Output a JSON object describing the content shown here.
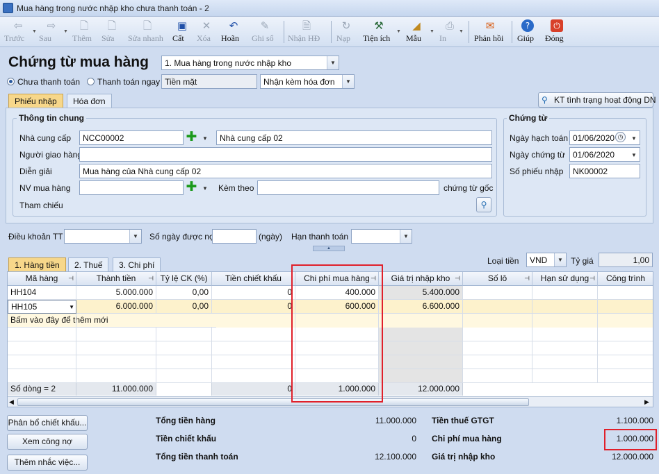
{
  "window": {
    "title": "Mua hàng trong nước nhập kho chưa thanh toán - 2"
  },
  "toolbar": {
    "items": [
      {
        "label": "Trước",
        "icon": "arrow-left-icon"
      },
      {
        "label": "Sau",
        "icon": "arrow-right-icon"
      },
      {
        "label": "Thêm",
        "icon": "add-document-icon"
      },
      {
        "label": "Sửa",
        "icon": "edit-document-icon"
      },
      {
        "label": "Sửa nhanh",
        "icon": "quick-edit-icon"
      },
      {
        "label": "Cất",
        "icon": "save-icon"
      },
      {
        "label": "Xóa",
        "icon": "delete-icon"
      },
      {
        "label": "Hoãn",
        "icon": "undo-icon"
      },
      {
        "label": "Ghi sổ",
        "icon": "pencil-icon"
      },
      {
        "label": "Nhận HĐ",
        "icon": "receive-invoice-icon"
      },
      {
        "label": "Nạp",
        "icon": "reload-icon"
      },
      {
        "label": "Tiện ích",
        "icon": "tools-icon"
      },
      {
        "label": "Mẫu",
        "icon": "template-icon"
      },
      {
        "label": "In",
        "icon": "print-icon"
      },
      {
        "label": "Phản hồi",
        "icon": "envelope-icon"
      },
      {
        "label": "Giúp",
        "icon": "help-icon"
      },
      {
        "label": "Đóng",
        "icon": "close-icon"
      }
    ]
  },
  "header": {
    "title": "Chứng từ mua hàng",
    "doc_type": "1. Mua hàng trong nước nhập kho",
    "radio_unpaid": "Chưa thanh toán",
    "radio_paid": "Thanh toán ngay",
    "payment_method": "Tiền mặt",
    "invoice_option": "Nhận kèm hóa đơn"
  },
  "tabs": {
    "receipt": "Phiếu nhập",
    "invoice": "Hóa đơn"
  },
  "kt_button": "KT tình trạng hoạt động DN",
  "general": {
    "title": "Thông tin chung",
    "supplier_label": "Nhà cung cấp",
    "supplier_code": "NCC00002",
    "supplier_name": "Nhà cung cấp 02",
    "deliverer_label": "Người giao hàng",
    "deliverer_value": "",
    "desc_label": "Diễn giải",
    "desc_value": "Mua hàng của Nhà cung cấp 02",
    "buyer_label": "NV mua hàng",
    "buyer_value": "",
    "attach_label": "Kèm theo",
    "attach_value": "",
    "attach_suffix": "chứng từ gốc",
    "ref_label": "Tham chiếu"
  },
  "voucher": {
    "title": "Chứng từ",
    "posting_date_label": "Ngày hạch toán",
    "posting_date": "01/06/2020",
    "doc_date_label": "Ngày chứng từ",
    "doc_date": "01/06/2020",
    "doc_no_label": "Số phiếu nhập",
    "doc_no": "NK00002"
  },
  "terms": {
    "payment_terms_label": "Điều khoản TT",
    "payment_terms": "",
    "credit_days_label": "Số ngày được nợ",
    "credit_days": "",
    "days_unit": "(ngày)",
    "due_date_label": "Hạn thanh toán",
    "due_date": ""
  },
  "lower_tabs": {
    "goods": "1. Hàng tiền",
    "tax": "2. Thuế",
    "cost": "3. Chi phí"
  },
  "currency": {
    "label": "Loại tiền",
    "value": "VND",
    "rate_label": "Tỷ giá",
    "rate": "1,00"
  },
  "grid": {
    "headers": [
      "Mã hàng",
      "Thành tiền",
      "Tỷ lệ CK (%)",
      "Tiền chiết khấu",
      "Chi phí mua hàng",
      "Giá trị nhập kho",
      "Số lô",
      "Hạn sử dụng",
      "Công trình"
    ],
    "rows": [
      {
        "code": "HH104",
        "amount": "5.000.000",
        "disc_rate": "0,00",
        "disc": "0",
        "cost": "400.000",
        "value": "5.400.000"
      },
      {
        "code": "HH105",
        "amount": "6.000.000",
        "disc_rate": "0,00",
        "disc": "0",
        "cost": "600.000",
        "value": "6.600.000"
      }
    ],
    "new_row_hint": "Bấm vào đây để thêm mới",
    "summary": {
      "count": "Số dòng = 2",
      "amount": "11.000.000",
      "disc": "0",
      "cost": "1.000.000",
      "value": "12.000.000"
    }
  },
  "buttons": {
    "allocate": "Phân bổ chiết khấu...",
    "debt": "Xem công nợ",
    "reminder": "Thêm nhắc việc..."
  },
  "totals": {
    "goods_label": "Tổng tiền hàng",
    "goods": "11.000.000",
    "discount_label": "Tiền chiết khấu",
    "discount": "0",
    "payment_label": "Tổng tiền thanh toán",
    "payment": "12.100.000",
    "vat_label": "Tiền thuế GTGT",
    "vat": "1.100.000",
    "cost_label": "Chi phí mua hàng",
    "cost": "1.000.000",
    "stock_label": "Giá trị nhập kho",
    "stock": "12.000.000"
  },
  "colors": {
    "highlight": "#e0202a",
    "active_tab": "#f7d78a",
    "selected_row": "#fdf2cc"
  }
}
